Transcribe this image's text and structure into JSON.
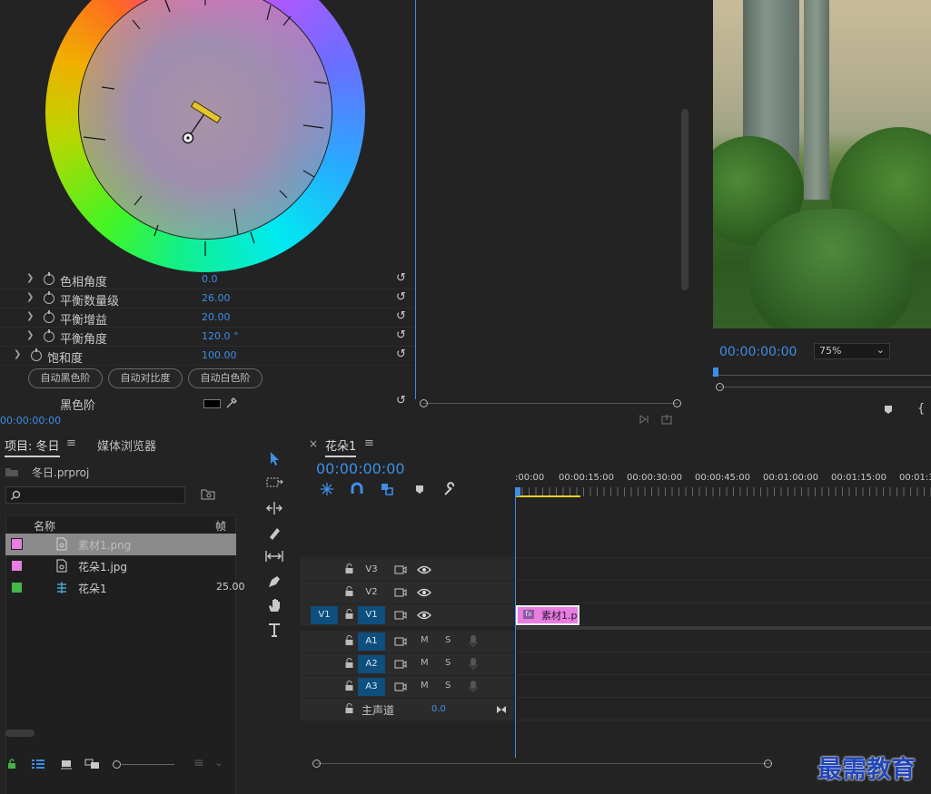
{
  "effect_controls": {
    "properties": [
      {
        "label": "色相角度",
        "value": "0.0",
        "indent": 1
      },
      {
        "label": "平衡数量级",
        "value": "26.00",
        "indent": 1
      },
      {
        "label": "平衡增益",
        "value": "20.00",
        "indent": 1
      },
      {
        "label": "平衡角度",
        "value": "120.0 °",
        "indent": 1
      },
      {
        "label": "饱和度",
        "value": "100.00",
        "indent": 0
      }
    ],
    "auto_buttons": [
      "自动黑色阶",
      "自动对比度",
      "自动白色阶"
    ],
    "black_level_label": "黑色阶",
    "timecode": "00:00:00:00"
  },
  "program_monitor": {
    "timecode": "00:00:00:00",
    "zoom": "75%"
  },
  "project_panel": {
    "tabs": [
      "项目: 冬日",
      "媒体浏览器"
    ],
    "project_file": "冬日.prproj",
    "search_placeholder": "",
    "columns": {
      "name": "名称",
      "fps": "帧速"
    },
    "items": [
      {
        "name": "素材1.png",
        "fps": "",
        "color": "#e77ee0",
        "selected": true
      },
      {
        "name": "花朵1.jpg",
        "fps": "",
        "color": "#e77ee0",
        "selected": false
      },
      {
        "name": "花朵1",
        "fps": "25.00",
        "color": "#46b84a",
        "selected": false
      }
    ]
  },
  "timeline": {
    "tab_label": "花朵1",
    "timecode": "00:00:00:00",
    "ruler": [
      ":00:00",
      "00:00:15:00",
      "00:00:30:00",
      "00:00:45:00",
      "00:01:00:00",
      "00:01:15:00",
      "00:01:3"
    ],
    "video_tracks": [
      "V3",
      "V2",
      "V1"
    ],
    "source_patch": "V1",
    "audio_tracks": [
      "A1",
      "A2",
      "A3"
    ],
    "mute_label": "M",
    "solo_label": "S",
    "master": {
      "label": "主声道",
      "value": "0.0"
    },
    "clip_label": "素材1.p",
    "clip_badge": "fx"
  },
  "watermark": "最需教育",
  "colors": {
    "accent_blue": "#3d8ee8",
    "clip_pink": "#e77ee0",
    "clip_green": "#46b84a",
    "track_active": "#0e4f7d",
    "work_area_yellow": "#e8d21d"
  },
  "icons": [
    "stopwatch-icon",
    "reset-icon",
    "eyedropper-icon",
    "selection-tool-icon",
    "track-select-icon",
    "ripple-edit-icon",
    "razor-icon",
    "slip-icon",
    "pen-icon",
    "hand-icon",
    "type-tool-icon",
    "lock-icon",
    "eye-icon",
    "film-icon",
    "mic-icon",
    "wrench-icon",
    "magnet-icon",
    "marker-icon",
    "folder-icon",
    "search-icon"
  ]
}
